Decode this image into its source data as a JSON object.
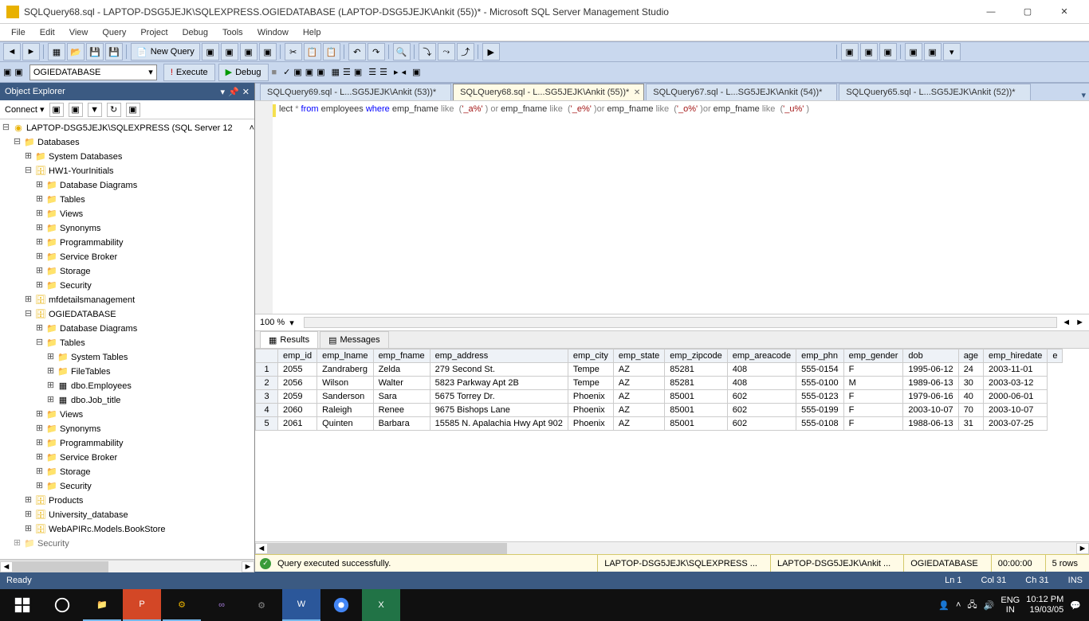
{
  "window": {
    "title": "SQLQuery68.sql - LAPTOP-DSG5JEJK\\SQLEXPRESS.OGIEDATABASE (LAPTOP-DSG5JEJK\\Ankit (55))* - Microsoft SQL Server Management Studio"
  },
  "menu": [
    "File",
    "Edit",
    "View",
    "Query",
    "Project",
    "Debug",
    "Tools",
    "Window",
    "Help"
  ],
  "toolbar": {
    "new_query": "New Query",
    "database_combo": "OGIEDATABASE",
    "execute": "Execute",
    "debug": "Debug"
  },
  "object_explorer": {
    "title": "Object Explorer",
    "connect_label": "Connect ▾",
    "root": "LAPTOP-DSG5JEJK\\SQLEXPRESS (SQL Server 12",
    "nodes": {
      "databases": "Databases",
      "sysdb": "System Databases",
      "hw1": "HW1-YourInitials",
      "dbdiag": "Database Diagrams",
      "tables": "Tables",
      "views": "Views",
      "synonyms": "Synonyms",
      "prog": "Programmability",
      "svcbroker": "Service Broker",
      "storage": "Storage",
      "security": "Security",
      "mfdetails": "mfdetailsmanagement",
      "ogie": "OGIEDATABASE",
      "systables": "System Tables",
      "filetables": "FileTables",
      "dbo_emp": "dbo.Employees",
      "dbo_job": "dbo.Job_title",
      "products": "Products",
      "univ": "University_database",
      "webapi": "WebAPIRc.Models.BookStore",
      "security2": "Security"
    }
  },
  "tabs": [
    {
      "label": "SQLQuery69.sql - L...SG5JEJK\\Ankit (53))*",
      "active": false
    },
    {
      "label": "SQLQuery68.sql - L...SG5JEJK\\Ankit (55))*",
      "active": true
    },
    {
      "label": "SQLQuery67.sql - L...SG5JEJK\\Ankit (54))*",
      "active": false
    },
    {
      "label": "SQLQuery65.sql - L...SG5JEJK\\Ankit (52))*",
      "active": false
    }
  ],
  "sql": {
    "prefix": "lect ",
    "line_rendered": true
  },
  "zoom": "100 %",
  "result_tabs": {
    "results": "Results",
    "messages": "Messages"
  },
  "columns": [
    "",
    "emp_id",
    "emp_lname",
    "emp_fname",
    "emp_address",
    "emp_city",
    "emp_state",
    "emp_zipcode",
    "emp_areacode",
    "emp_phn",
    "emp_gender",
    "dob",
    "age",
    "emp_hiredate",
    "e"
  ],
  "rows": [
    [
      "1",
      "2055",
      "Zandraberg",
      "Zelda",
      "279 Second St.",
      "Tempe",
      "AZ",
      "85281",
      "408",
      "555-0154",
      "F",
      "1995-06-12",
      "24",
      "2003-11-01"
    ],
    [
      "2",
      "2056",
      "Wilson",
      "Walter",
      "5823 Parkway Apt 2B",
      "Tempe",
      "AZ",
      "85281",
      "408",
      "555-0100",
      "M",
      "1989-06-13",
      "30",
      "2003-03-12"
    ],
    [
      "3",
      "2059",
      "Sanderson",
      "Sara",
      "5675 Torrey Dr.",
      "Phoenix",
      "AZ",
      "85001",
      "602",
      "555-0123",
      "F",
      "1979-06-16",
      "40",
      "2000-06-01"
    ],
    [
      "4",
      "2060",
      "Raleigh",
      "Renee",
      "9675 Bishops Lane",
      "Phoenix",
      "AZ",
      "85001",
      "602",
      "555-0199",
      "F",
      "2003-10-07",
      "70",
      "2003-10-07"
    ],
    [
      "5",
      "2061",
      "Quinten",
      "Barbara",
      "15585 N. Apalachia Hwy Apt 902",
      "Phoenix",
      "AZ",
      "85001",
      "602",
      "555-0108",
      "F",
      "1988-06-13",
      "31",
      "2003-07-25"
    ]
  ],
  "resultbar": {
    "msg": "Query executed successfully.",
    "server": "LAPTOP-DSG5JEJK\\SQLEXPRESS ...",
    "user": "LAPTOP-DSG5JEJK\\Ankit ...",
    "db": "OGIEDATABASE",
    "time": "00:00:00",
    "rows": "5 rows"
  },
  "statusbar": {
    "ready": "Ready",
    "ln": "Ln 1",
    "col": "Col 31",
    "ch": "Ch 31",
    "ins": "INS"
  },
  "taskbar": {
    "lang1": "ENG",
    "lang2": "IN",
    "time": "10:12 PM",
    "date": "19/03/05"
  }
}
